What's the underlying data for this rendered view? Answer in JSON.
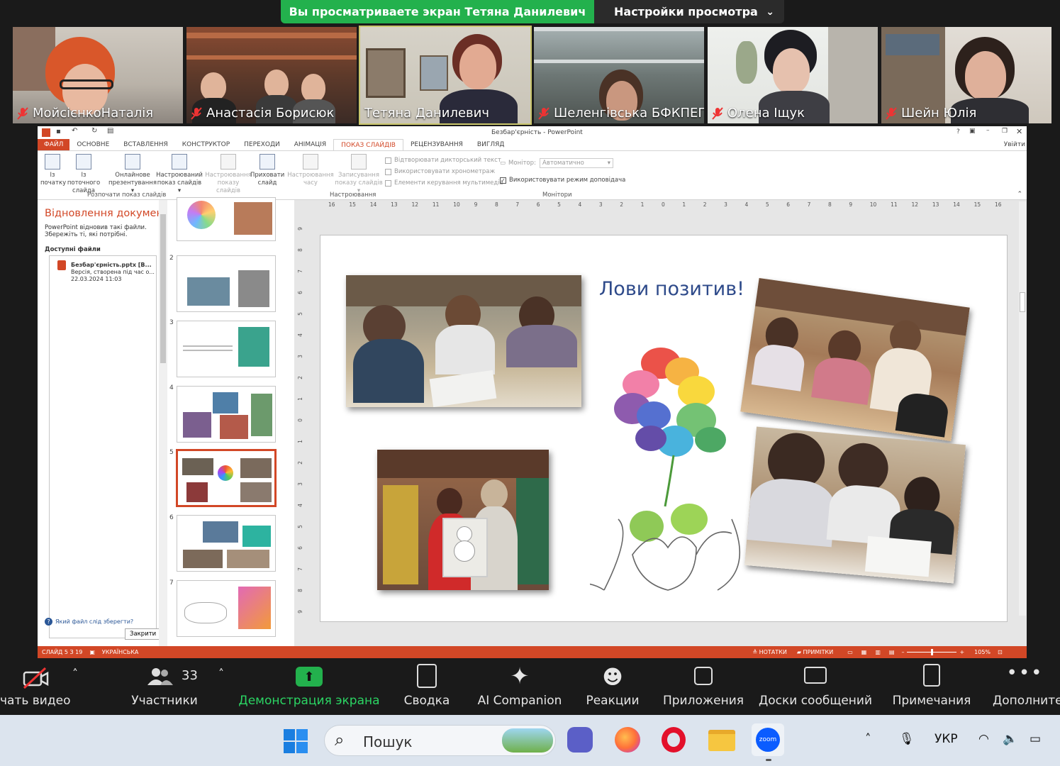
{
  "banner": {
    "viewing_text": "Вы просматриваете экран Тетяна Данилевич",
    "view_options_label": "Настройки просмотра"
  },
  "participants": [
    {
      "name": "МойсієнкоНаталія",
      "muted": true
    },
    {
      "name": "Анастасія Борисюк",
      "muted": true
    },
    {
      "name": "Тетяна Данилевич",
      "muted": false
    },
    {
      "name": "Шеленгівська БФКПЕП",
      "muted": true
    },
    {
      "name": "Олена Іщук",
      "muted": true
    },
    {
      "name": "Шейн Юлія",
      "muted": true
    }
  ],
  "ppt": {
    "window_title": "Безбар'єрність - PowerPoint",
    "help": "?",
    "signin": "Увійти",
    "tabs": [
      "ФАЙЛ",
      "ОСНОВНЕ",
      "ВСТАВЛЕННЯ",
      "КОНСТРУКТОР",
      "ПЕРЕХОДИ",
      "АНІМАЦІЯ",
      "ПОКАЗ СЛАЙДІВ",
      "РЕЦЕНЗУВАННЯ",
      "ВИГЛЯД"
    ],
    "active_tab": "ПОКАЗ СЛАЙДІВ",
    "ribbon": {
      "btn_from_start": [
        "Із",
        "початку"
      ],
      "btn_from_current": [
        "Із поточного",
        "слайда"
      ],
      "btn_online": [
        "Онлайнове",
        "презентування ▾"
      ],
      "btn_custom": [
        "Настроюваний",
        "показ слайдів ▾"
      ],
      "group_start": "Розпочати показ слайдів",
      "btn_setup": [
        "Настроювання",
        "показу слайдів"
      ],
      "btn_hide": [
        "Приховати",
        "слайд"
      ],
      "btn_timings": [
        "Настроювання",
        "часу"
      ],
      "btn_record": [
        "Записування",
        "показу слайдів ▾"
      ],
      "chk_narration": "Відтворювати дикторський текст",
      "chk_timings": "Використовувати хронометраж",
      "chk_media": "Елементи керування мультимедіа",
      "group_setup": "Настроювання",
      "monitor_label": "Монітор:",
      "monitor_value": "Автоматично",
      "chk_presenter": "Використовувати режим доповідача",
      "group_monitors": "Монітори"
    },
    "recovery": {
      "title": "Відновлення докумен...",
      "desc": "PowerPoint відновив такі файли. Збережіть ті, які потрібні.",
      "available": "Доступні файли",
      "file_name": "Безбар'єрність.pptx  [В...",
      "file_version": "Версія, створена під час о...",
      "file_date": "22.03.2024 11:03",
      "question": "Який файл слід зберегти?",
      "close": "Закрити"
    },
    "thumb_numbers": [
      "2",
      "3",
      "4",
      "5",
      "6",
      "7"
    ],
    "ruler_h": [
      "16",
      "15",
      "14",
      "13",
      "12",
      "11",
      "10",
      "9",
      "8",
      "7",
      "6",
      "5",
      "4",
      "3",
      "2",
      "1",
      "0",
      "1",
      "2",
      "3",
      "4",
      "5",
      "6",
      "7",
      "8",
      "9",
      "10",
      "11",
      "12",
      "13",
      "14",
      "15",
      "16"
    ],
    "ruler_v": [
      "9",
      "8",
      "7",
      "6",
      "5",
      "4",
      "3",
      "2",
      "1",
      "0",
      "1",
      "2",
      "3",
      "4",
      "5",
      "6",
      "7",
      "8",
      "9"
    ],
    "slide_title": "Лови позитив!",
    "status": {
      "slide": "СЛАЙД 5 З 19",
      "language": "УКРАЇНСЬКА",
      "notes": "НОТАТКИ",
      "comments": "ПРИМІТКИ",
      "zoom": "105%"
    }
  },
  "zoom_toolbar": {
    "video": "чать видео",
    "participants": "Участники",
    "participants_count": "33",
    "share": "Демонстрация экрана",
    "summary": "Сводка",
    "ai": "AI Companion",
    "reactions": "Реакции",
    "apps": "Приложения",
    "whiteboards": "Доски сообщений",
    "notes": "Примечания",
    "more": "Дополните"
  },
  "taskbar": {
    "search_placeholder": "Пошук",
    "language": "УКР"
  },
  "colors": {
    "zoom_green": "#23b14d",
    "ppt_accent": "#d24726",
    "slide_title": "#2e4a8a"
  }
}
